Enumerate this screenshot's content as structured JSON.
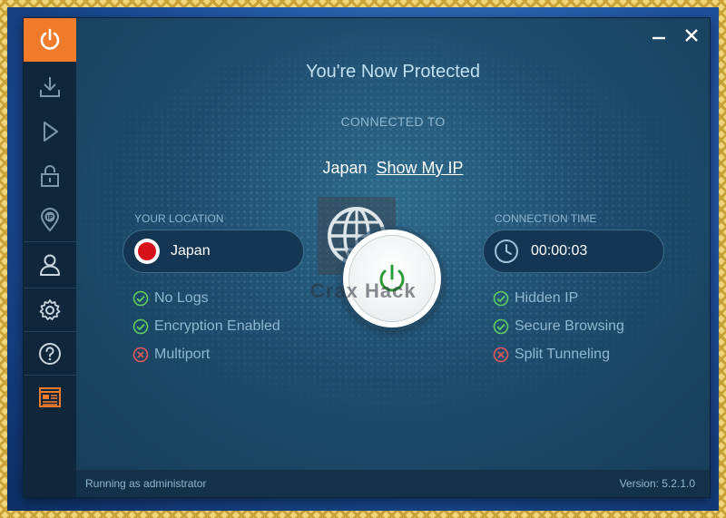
{
  "window": {
    "minimize_symbol": "—",
    "close_symbol": "✕"
  },
  "sidebar": {
    "items": [
      {
        "name": "power-icon",
        "active": true
      },
      {
        "name": "download-icon"
      },
      {
        "name": "play-icon"
      },
      {
        "name": "lock-icon"
      },
      {
        "name": "ip-pin-icon"
      },
      {
        "name": "user-icon"
      },
      {
        "name": "gear-icon"
      },
      {
        "name": "help-icon"
      },
      {
        "name": "news-icon"
      }
    ]
  },
  "main": {
    "headline": "You're Now Protected",
    "connected_to_label": "CONNECTED TO",
    "country": "Japan",
    "show_ip_link": "Show My IP"
  },
  "location": {
    "label": "YOUR LOCATION",
    "value": "Japan",
    "flag_color": "#d8121a"
  },
  "connection": {
    "label": "CONNECTION TIME",
    "value": "00:00:03"
  },
  "features_left": [
    {
      "label": "No Logs",
      "status": "enabled"
    },
    {
      "label": "Encryption Enabled",
      "status": "enabled"
    },
    {
      "label": "Multiport",
      "status": "disabled"
    }
  ],
  "features_right": [
    {
      "label": "Hidden IP",
      "status": "enabled"
    },
    {
      "label": "Secure Browsing",
      "status": "enabled"
    },
    {
      "label": "Split Tunneling",
      "status": "disabled"
    }
  ],
  "watermark": {
    "text": "Crax Hack"
  },
  "status": {
    "left": "Running as administrator",
    "version": "Version:  5.2.1.0"
  },
  "colors": {
    "accent": "#f07b2a",
    "enabled": "#5fcf5f",
    "disabled": "#e05a5a",
    "power_ring": "#2e9a3a"
  }
}
